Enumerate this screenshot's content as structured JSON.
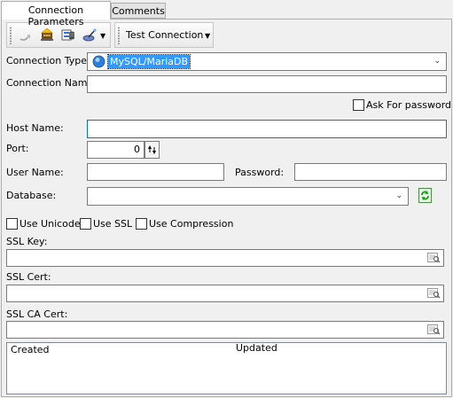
{
  "tabs": [
    {
      "label": "Connection Parameters",
      "active": true
    },
    {
      "label": "Comments",
      "active": false
    }
  ],
  "toolbar": {
    "icons": [
      "connect-icon",
      "new-icon",
      "database-icon",
      "wand-icon"
    ],
    "test_connection_label": "Test Connection"
  },
  "form": {
    "connection_type_label": "Connection Type:",
    "connection_type_value": "MySQL/MariaDB",
    "connection_name_label": "Connection Name:",
    "connection_name_value": "",
    "ask_for_password_label": "Ask For password",
    "host_name_label": "Host Name:",
    "host_name_value": "",
    "port_label": "Port:",
    "port_value": "0",
    "user_name_label": "User Name:",
    "user_name_value": "",
    "password_label": "Password:",
    "password_value": "",
    "database_label": "Database:",
    "database_value": "",
    "use_unicode_label": "Use Unicode",
    "use_ssl_label": "Use SSL",
    "use_compression_label": "Use Compression",
    "ssl_key_label": "SSL Key:",
    "ssl_cert_label": "SSL Cert:",
    "ssl_ca_cert_label": "SSL CA Cert:"
  },
  "grid": {
    "columns": [
      "Created",
      "Updated"
    ]
  },
  "colors": {
    "selection": "#3399ff",
    "focus_border": "#0078d7"
  }
}
